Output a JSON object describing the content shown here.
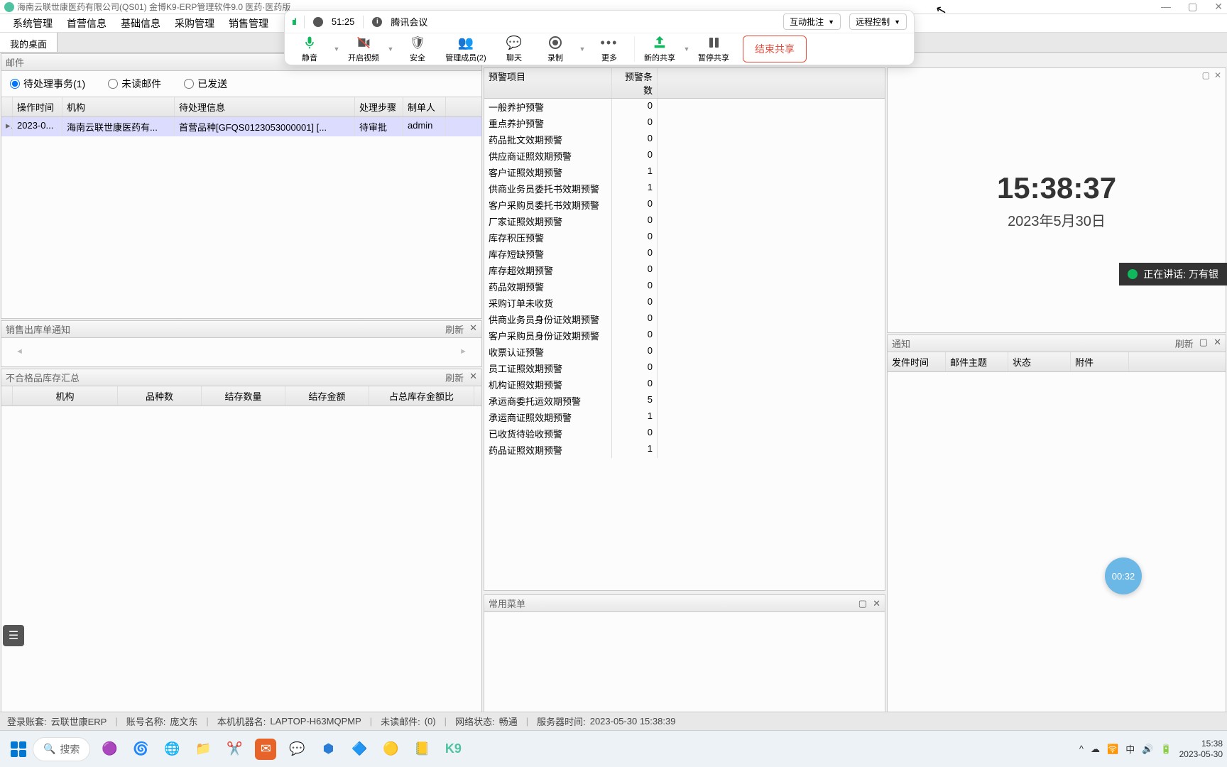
{
  "window": {
    "title": "海南云联世康医药有限公司(QS01)  金博K9-ERP管理软件9.0   医药·医药版"
  },
  "menu": [
    "系统管理",
    "首营信息",
    "基础信息",
    "采购管理",
    "销售管理"
  ],
  "tabs": [
    "我的桌面"
  ],
  "meeting": {
    "timer": "51:25",
    "name": "腾讯会议",
    "annotate": "互动批注",
    "remote": "远程控制",
    "actions": {
      "mute": "静音",
      "video": "开启视频",
      "security": "安全",
      "members": "管理成员(2)",
      "chat": "聊天",
      "record": "录制",
      "more": "更多",
      "newshare": "新的共享",
      "pause": "暂停共享",
      "end": "结束共享"
    }
  },
  "mail": {
    "title": "邮件",
    "filters": {
      "pending": "待处理事务(1)",
      "unread": "未读邮件",
      "sent": "已发送"
    },
    "columns": {
      "time": "操作时间",
      "org": "机构",
      "info": "待处理信息",
      "step": "处理步骤",
      "maker": "制单人"
    },
    "row": {
      "time": "2023-0...",
      "org": "海南云联世康医药有...",
      "info": "首营品种[GFQS0123053000001] [...",
      "step": "待审批",
      "maker": "admin"
    }
  },
  "sales": {
    "title": "销售出库单通知",
    "refresh": "刷新"
  },
  "defect": {
    "title": "不合格品库存汇总",
    "refresh": "刷新",
    "columns": {
      "org": "机构",
      "pz": "品种数",
      "qty": "结存数量",
      "amt": "结存金额",
      "pct": "占总库存金额比"
    }
  },
  "alerts": {
    "columns": {
      "item": "预警项目",
      "count": "预警条数"
    },
    "rows": [
      {
        "item": "一般养护预警",
        "count": "0"
      },
      {
        "item": "重点养护预警",
        "count": "0"
      },
      {
        "item": "药品批文效期预警",
        "count": "0"
      },
      {
        "item": "供应商证照效期预警",
        "count": "0"
      },
      {
        "item": "客户证照效期预警",
        "count": "1"
      },
      {
        "item": "供商业务员委托书效期预警",
        "count": "1"
      },
      {
        "item": "客户采购员委托书效期预警",
        "count": "0"
      },
      {
        "item": "厂家证照效期预警",
        "count": "0"
      },
      {
        "item": "库存积压预警",
        "count": "0"
      },
      {
        "item": "库存短缺预警",
        "count": "0"
      },
      {
        "item": "库存超效期预警",
        "count": "0"
      },
      {
        "item": "药品效期预警",
        "count": "0"
      },
      {
        "item": "采购订单未收货",
        "count": "0"
      },
      {
        "item": "供商业务员身份证效期预警",
        "count": "0"
      },
      {
        "item": "客户采购员身份证效期预警",
        "count": "0"
      },
      {
        "item": "收票认证预警",
        "count": "0"
      },
      {
        "item": "员工证照效期预警",
        "count": "0"
      },
      {
        "item": "机构证照效期预警",
        "count": "0"
      },
      {
        "item": "承运商委托运效期预警",
        "count": "5"
      },
      {
        "item": "承运商证照效期预警",
        "count": "1"
      },
      {
        "item": "已收货待验收预警",
        "count": "0"
      },
      {
        "item": "药品证照效期预警",
        "count": "1"
      }
    ]
  },
  "common_menu": {
    "title": "常用菜单"
  },
  "clock": {
    "time": "15:38:37",
    "date": "2023年5月30日"
  },
  "notice": {
    "title": "通知",
    "refresh": "刷新",
    "columns": {
      "send": "发件时间",
      "subj": "邮件主题",
      "stat": "状态",
      "att": "附件"
    }
  },
  "speaking": {
    "label": "正在讲话: 万有银"
  },
  "timer_bubble": "00:32",
  "status": {
    "set": {
      "label": "登录账套:",
      "val": "云联世康ERP"
    },
    "acct": {
      "label": "账号名称:",
      "val": "庞文东"
    },
    "host": {
      "label": "本机机器名:",
      "val": "LAPTOP-H63MQPMP"
    },
    "unread": {
      "label": "未读邮件:",
      "val": "(0)"
    },
    "net": {
      "label": "网络状态:",
      "val": "畅通"
    },
    "srv": {
      "label": "服务器时间:",
      "val": "2023-05-30 15:38:39"
    }
  },
  "taskbar": {
    "search": "搜索",
    "ime": "中",
    "clock_time": "15:38",
    "clock_date": "2023-05-30"
  }
}
